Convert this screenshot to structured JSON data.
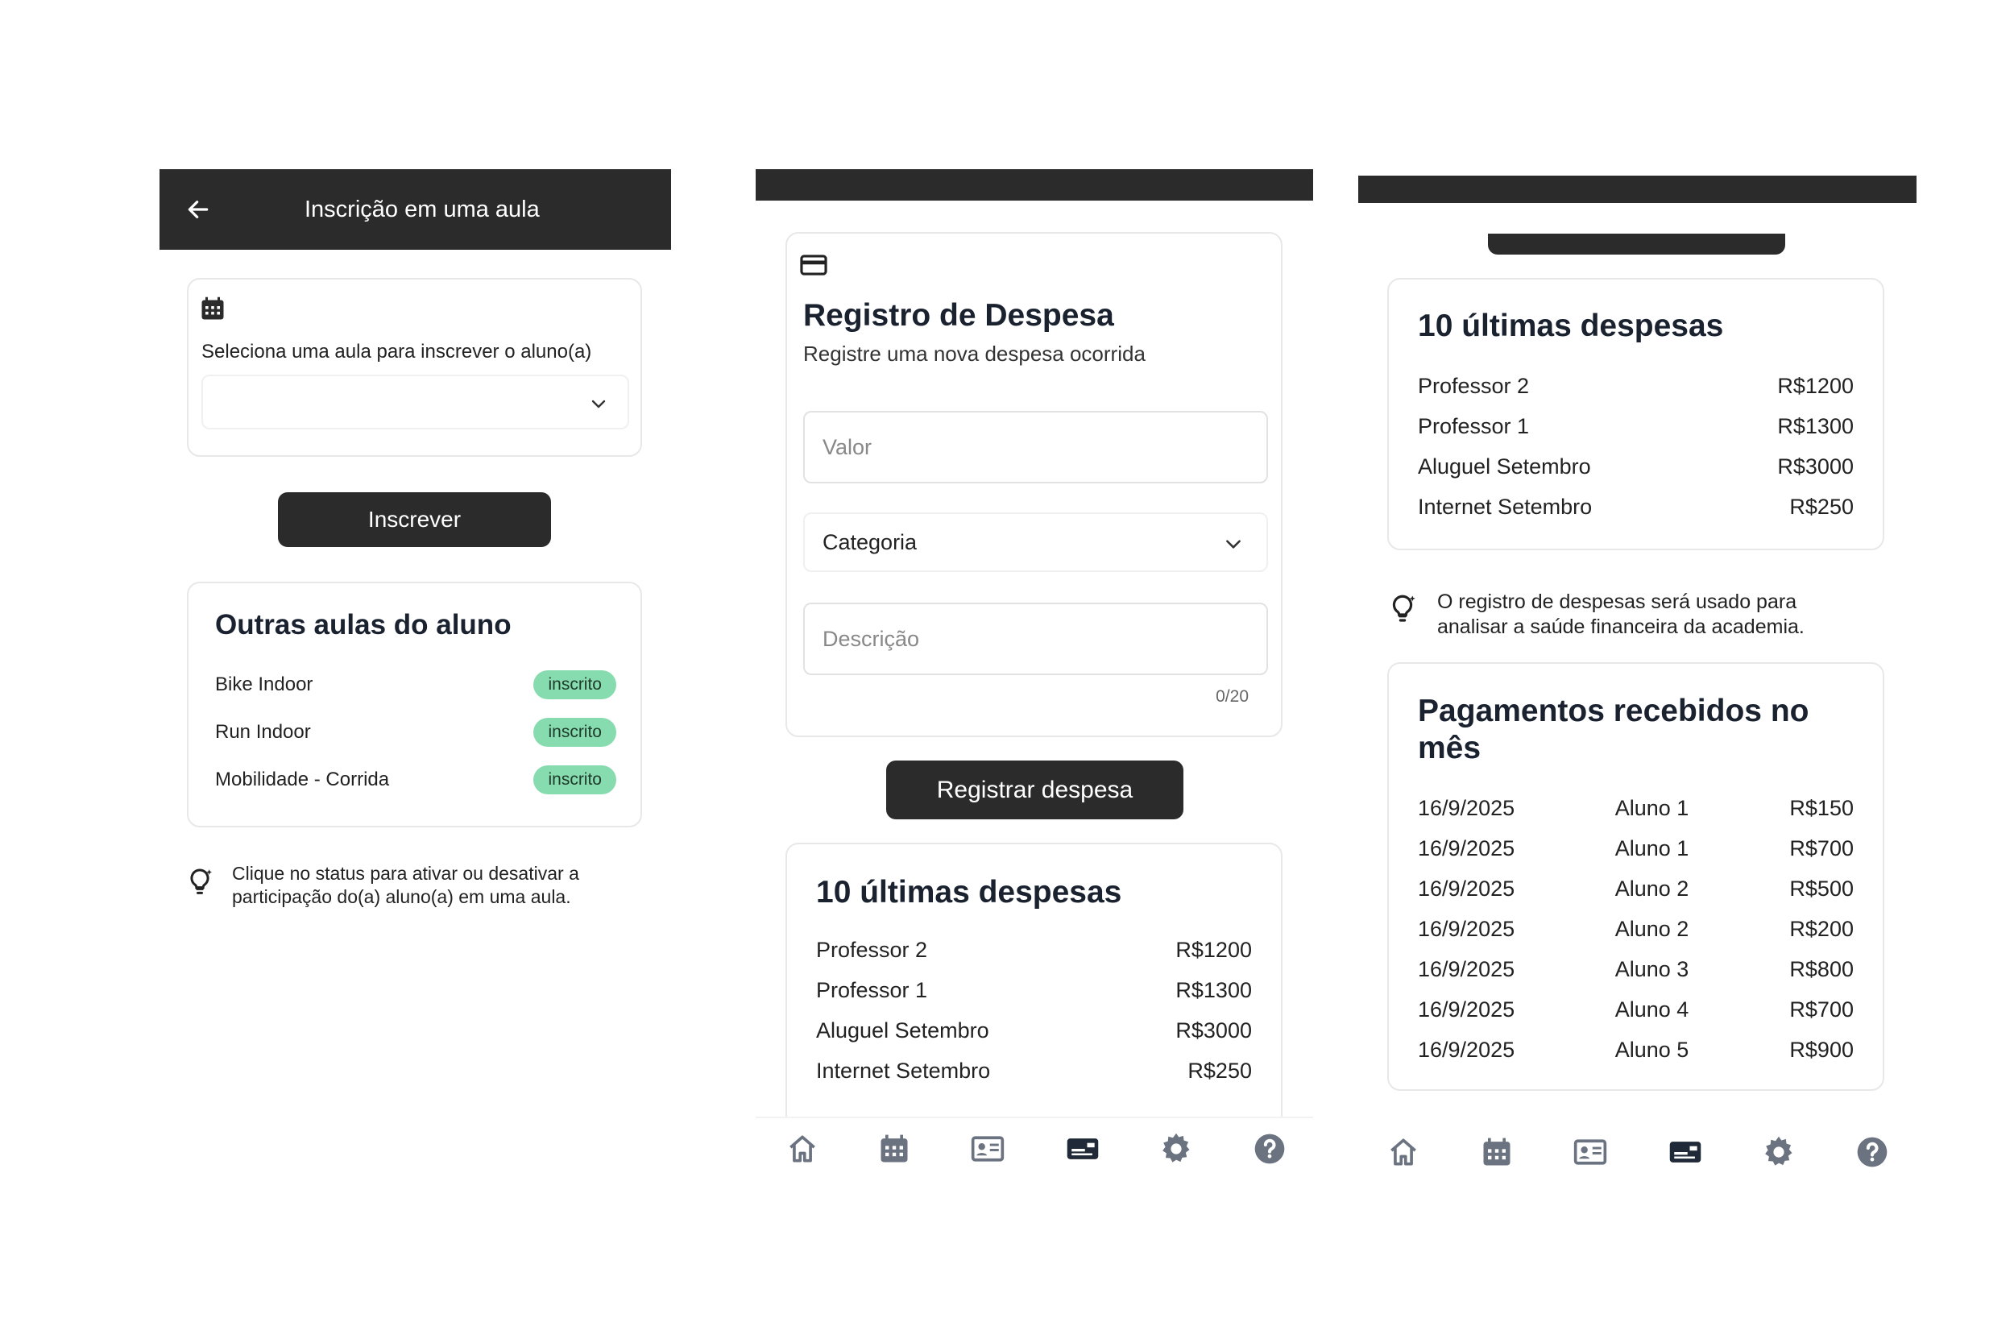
{
  "panel1": {
    "header_title": "Inscrição em uma aula",
    "select_label": "Seleciona uma aula para inscrever o aluno(a)",
    "select_value": "",
    "enroll_button": "Inscrever",
    "other_classes_title": "Outras aulas do aluno",
    "classes": [
      {
        "name": "Bike Indoor",
        "status": "inscrito"
      },
      {
        "name": "Run Indoor",
        "status": "inscrito"
      },
      {
        "name": "Mobilidade - Corrida",
        "status": "inscrito"
      }
    ],
    "tip": "Clique no status para ativar ou desativar a participação do(a) aluno(a) em uma aula."
  },
  "panel2": {
    "form_title": "Registro de Despesa",
    "form_subtitle": "Registre uma nova despesa ocorrida",
    "valor_placeholder": "Valor",
    "categoria_value": "Categoria",
    "descricao_placeholder": "Descrição",
    "char_counter": "0/20",
    "register_button": "Registrar despesa",
    "last_expenses_title": "10 últimas despesas",
    "expenses": [
      {
        "name": "Professor 2",
        "amount": "R$1200"
      },
      {
        "name": "Professor 1",
        "amount": "R$1300"
      },
      {
        "name": "Aluguel Setembro",
        "amount": "R$3000"
      },
      {
        "name": "Internet Setembro",
        "amount": "R$250"
      }
    ]
  },
  "panel3": {
    "last_expenses_title": "10 últimas despesas",
    "expenses": [
      {
        "name": "Professor 2",
        "amount": "R$1200"
      },
      {
        "name": "Professor 1",
        "amount": "R$1300"
      },
      {
        "name": "Aluguel Setembro",
        "amount": "R$3000"
      },
      {
        "name": "Internet Setembro",
        "amount": "R$250"
      }
    ],
    "tip": "O registro de despesas será usado para analisar a saúde financeira da academia.",
    "payments_title": "Pagamentos recebidos no mês",
    "payments": [
      {
        "date": "16/9/2025",
        "student": "Aluno 1",
        "amount": "R$150"
      },
      {
        "date": "16/9/2025",
        "student": "Aluno 1",
        "amount": "R$700"
      },
      {
        "date": "16/9/2025",
        "student": "Aluno 2",
        "amount": "R$500"
      },
      {
        "date": "16/9/2025",
        "student": "Aluno 2",
        "amount": "R$200"
      },
      {
        "date": "16/9/2025",
        "student": "Aluno 3",
        "amount": "R$800"
      },
      {
        "date": "16/9/2025",
        "student": "Aluno 4",
        "amount": "R$700"
      },
      {
        "date": "16/9/2025",
        "student": "Aluno 5",
        "amount": "R$900"
      }
    ]
  },
  "nav": {
    "items": [
      "home-icon",
      "calendar-icon",
      "id-card-icon",
      "expenses-card-icon",
      "settings-gear-icon",
      "help-icon"
    ],
    "active": "expenses-card-icon",
    "active_color": "#1f2937",
    "inactive_color": "#6b7280"
  }
}
